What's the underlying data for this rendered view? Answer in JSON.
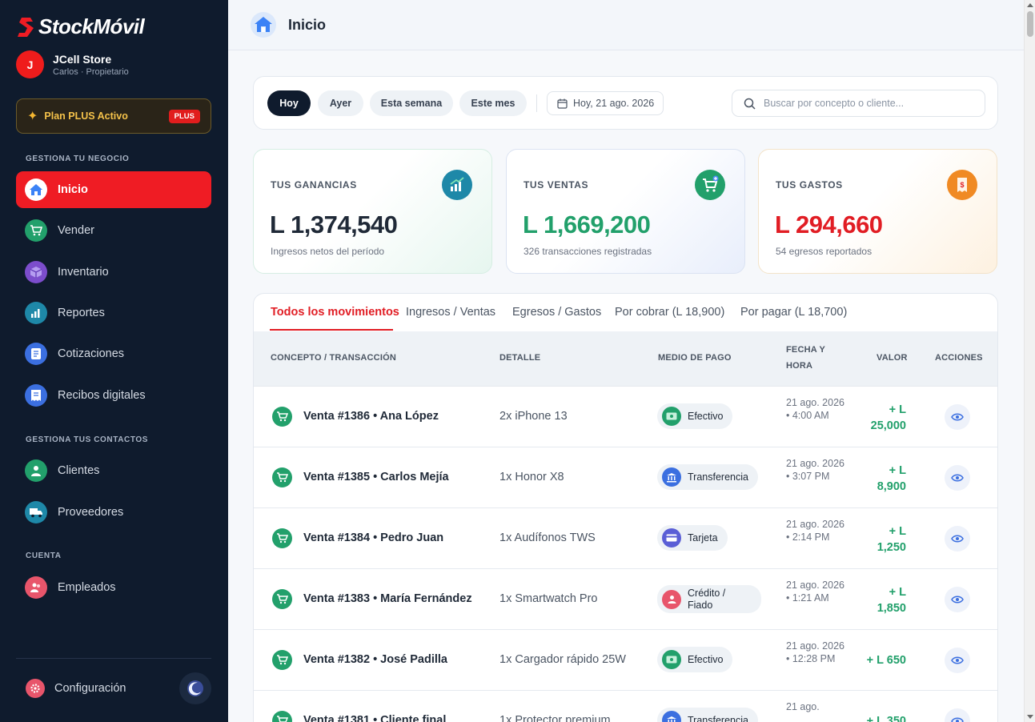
{
  "brand": {
    "name": "StockMóvil",
    "accent": "#ef1c24",
    "sidebar_bg": "#0f1b2d"
  },
  "store": {
    "avatar_letter": "J",
    "name": "JCell Store",
    "subtitle": "Carlos · Propietario"
  },
  "plan": {
    "label": "Plan PLUS Activo",
    "badge": "PLUS"
  },
  "sidebar": {
    "sections": [
      "GESTIONA TU NEGOCIO",
      "GESTIONA TUS CONTACTOS",
      "CUENTA"
    ],
    "items": [
      {
        "label": "Inicio",
        "icon": "home-icon",
        "active": true
      },
      {
        "label": "Vender",
        "icon": "cart-icon"
      },
      {
        "label": "Inventario",
        "icon": "box-icon"
      },
      {
        "label": "Reportes",
        "icon": "chart-icon"
      },
      {
        "label": "Cotizaciones",
        "icon": "document-icon"
      },
      {
        "label": "Recibos digitales",
        "icon": "receipt-icon"
      },
      {
        "label": "Clientes",
        "icon": "customers-icon"
      },
      {
        "label": "Proveedores",
        "icon": "truck-icon"
      },
      {
        "label": "Empleados",
        "icon": "employees-icon"
      }
    ],
    "settings_label": "Configuración"
  },
  "header": {
    "title": "Inicio"
  },
  "filters": {
    "chips": [
      "Hoy",
      "Ayer",
      "Esta semana",
      "Este mes"
    ],
    "active_chip": "Hoy",
    "date": "Hoy, 21 ago. 2026",
    "search_placeholder": "Buscar por concepto o cliente..."
  },
  "stats": [
    {
      "label": "TUS GANANCIAS",
      "value": "L 1,374,540",
      "sub": "Ingresos netos del período",
      "color": "#1f2937"
    },
    {
      "label": "TUS VENTAS",
      "value": "L 1,669,200",
      "sub": "326 transacciones registradas",
      "color": "#22a06b"
    },
    {
      "label": "TUS GASTOS",
      "value": "L 294,660",
      "sub": "54 egresos reportados",
      "color": "#e11d24"
    }
  ],
  "tabs": [
    "Todos los movimientos",
    "Ingresos / Ventas",
    "Egresos / Gastos",
    "Por cobrar (L 18,900)",
    "Por pagar (L 18,700)"
  ],
  "table": {
    "headers": {
      "concept": "CONCEPTO / TRANSACCIÓN",
      "detail": "DETALLE",
      "payment": "MEDIO DE PAGO",
      "date_1": "FECHA Y",
      "date_2": "HORA",
      "value": "VALOR",
      "actions": "ACCIONES"
    },
    "rows": [
      {
        "concept": "Venta #1386 • Ana López",
        "detail": "2x iPhone 13",
        "payment": "Efectivo",
        "pay_icon": "cash-icon",
        "date": "21 ago. 2026 • 4:00 AM",
        "value": "+ L 25,000"
      },
      {
        "concept": "Venta #1385 • Carlos Mejía",
        "detail": "1x Honor X8",
        "payment": "Transferencia",
        "pay_icon": "bank-icon",
        "date": "21 ago. 2026 • 3:07 PM",
        "value": "+ L 8,900"
      },
      {
        "concept": "Venta #1384 • Pedro Juan",
        "detail": "1x Audífonos TWS",
        "payment": "Tarjeta",
        "pay_icon": "card-icon",
        "date": "21 ago. 2026 • 2:14 PM",
        "value": "+ L 1,250"
      },
      {
        "concept": "Venta #1383 • María Fernández",
        "detail": "1x Smartwatch Pro",
        "payment": "Crédito / Fiado",
        "pay_icon": "credit-icon",
        "date": "21 ago. 2026 • 1:21 AM",
        "value": "+ L 1,850"
      },
      {
        "concept": "Venta #1382 • José Padilla",
        "detail": "1x Cargador rápido 25W",
        "payment": "Efectivo",
        "pay_icon": "cash-icon",
        "date": "21 ago. 2026 • 12:28 PM",
        "value": "+ L 650"
      },
      {
        "concept": "Venta #1381 • Cliente final",
        "detail": "1x Protector premium",
        "payment": "Transferencia",
        "pay_icon": "bank-icon",
        "date": "21 ago.",
        "value": "+ L 350"
      }
    ]
  }
}
